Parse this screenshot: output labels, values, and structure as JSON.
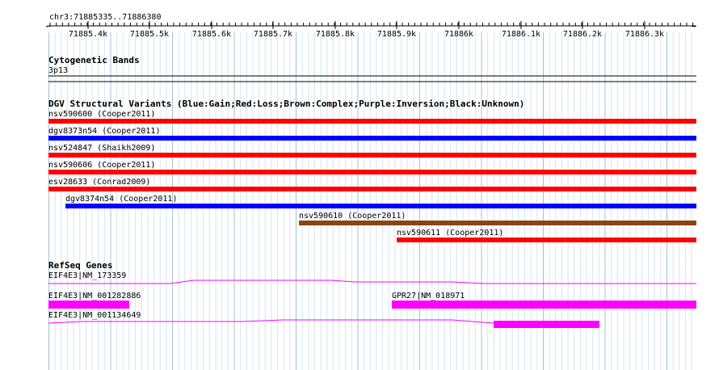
{
  "ruler": {
    "location": "chr3:71885335..71886380",
    "ticks": [
      "71885.4k",
      "71885.5k",
      "71885.6k",
      "71885.7k",
      "71885.8k",
      "71885.9k",
      "71886k",
      "71886.1k",
      "71886.2k",
      "71886.3k"
    ]
  },
  "cytoband_track": {
    "title": "Cytogenetic Bands",
    "band": "3p13"
  },
  "dgv_track": {
    "title": "DGV Structural Variants (Blue:Gain;Red:Loss;Brown:Complex;Purple:Inversion;Black:Unknown)",
    "colors": {
      "gain": "#0000ff",
      "loss": "#ff0000",
      "complex": "#8b4513",
      "inversion": "#800080",
      "unknown": "#000000"
    },
    "features": [
      {
        "label": "nsv590600 (Cooper2011)",
        "type": "loss"
      },
      {
        "label": "dgv8373n54 (Cooper2011)",
        "type": "gain"
      },
      {
        "label": "nsv524847 (Shaikh2009)",
        "type": "loss"
      },
      {
        "label": "nsv590606 (Cooper2011)",
        "type": "loss"
      },
      {
        "label": "esv28633 (Conrad2009)",
        "type": "loss"
      },
      {
        "label": "dgv8374n54 (Cooper2011)",
        "type": "gain"
      },
      {
        "label": "nsv590610 (Cooper2011)",
        "type": "complex"
      },
      {
        "label": "nsv590611 (Cooper2011)",
        "type": "loss"
      }
    ]
  },
  "refseq_track": {
    "title": "RefSeq Genes",
    "color": "#ff00ff",
    "genes": [
      {
        "label": "EIF4E3|NM_173359"
      },
      {
        "label": "EIF4E3|NM_001282886"
      },
      {
        "label": "GPR27|NM_018971"
      },
      {
        "label": "EIF4E3|NM_001134649"
      }
    ]
  }
}
